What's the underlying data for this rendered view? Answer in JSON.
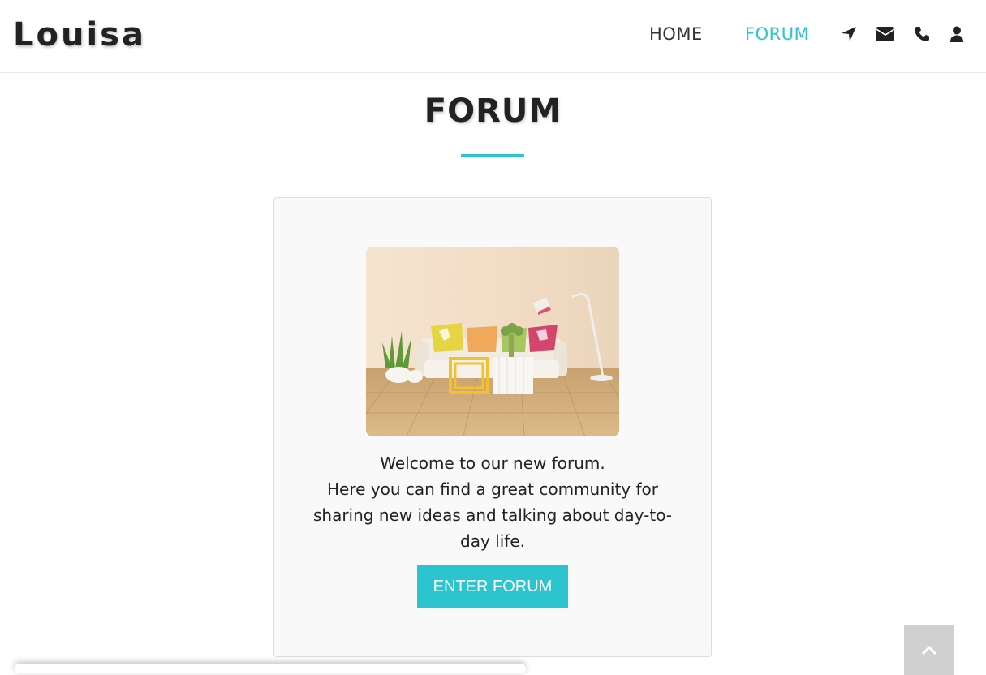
{
  "brand": {
    "logo_text": "Louisa"
  },
  "nav": {
    "items": [
      {
        "label": "HOME",
        "active": false
      },
      {
        "label": "FORUM",
        "active": true
      }
    ],
    "icons": [
      "location-arrow-icon",
      "envelope-icon",
      "phone-icon",
      "user-icon"
    ]
  },
  "page": {
    "title": "FORUM"
  },
  "card": {
    "image": "living-room-sofa-photo",
    "description_lines": [
      "Welcome to our new forum.",
      "Here you can find a great community for",
      "sharing new ideas and talking about day-to-",
      "day life."
    ],
    "button_label": "ENTER FORUM"
  },
  "scroll_top": {
    "icon": "chevron-up-icon"
  },
  "colors": {
    "accent": "#2bc4cf",
    "text": "#222222",
    "card_bg": "#f9f9f9"
  }
}
